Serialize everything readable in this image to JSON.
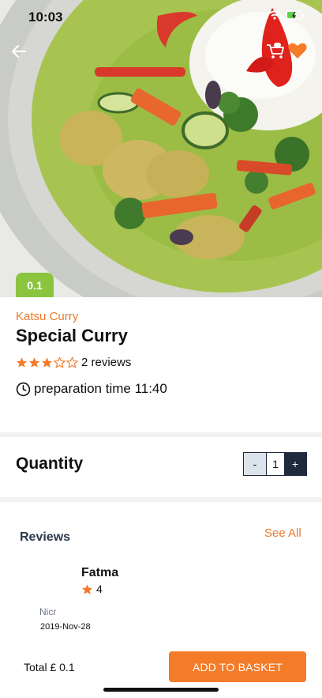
{
  "status_bar": {
    "time": "10:03"
  },
  "hero": {
    "price_badge": "0.1"
  },
  "product": {
    "category": "Katsu Curry",
    "title": "Special Curry",
    "rating": 3,
    "rating_max": 5,
    "reviews_label": "2 reviews",
    "prep_label": "preparation time 11:40"
  },
  "quantity": {
    "label": "Quantity",
    "minus": "-",
    "value": "1",
    "plus": "+"
  },
  "reviews": {
    "title": "Reviews",
    "see_all": "See All",
    "items": [
      {
        "name": "Fatma",
        "rating": "4",
        "text": "Nicr",
        "date": "2019-Nov-28"
      }
    ]
  },
  "footer": {
    "total": "Total £ 0.1",
    "add_button": "ADD TO BASKET"
  },
  "colors": {
    "accent": "#f47b28",
    "badge": "#8bc53f",
    "dark": "#1f2a3c"
  }
}
